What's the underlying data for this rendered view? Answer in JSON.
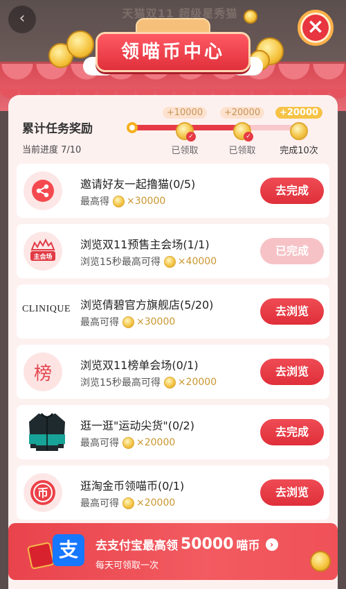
{
  "header": {
    "back_glyph": "‹",
    "title": "天猫双11 超级星秀猫",
    "banner": "领喵币中心",
    "close_glyph": "×"
  },
  "progress": {
    "title": "累计任务奖励",
    "current": "当前进度 7/10",
    "value_fraction": 0.7,
    "milestones": [
      {
        "reward": "+10000",
        "label": "已领取",
        "claimed": true
      },
      {
        "reward": "+20000",
        "label": "已领取",
        "claimed": true
      },
      {
        "reward": "+20000",
        "label": "完成10次",
        "claimed": false
      }
    ]
  },
  "tasks": [
    {
      "title": "邀请好友一起撸猫(0/5)",
      "reward_prefix": "最高得",
      "amount": "×30000",
      "button": "去完成",
      "done": false,
      "icon": "share-icon"
    },
    {
      "title": "浏览双11预售主会场(1/1)",
      "reward_prefix": "浏览15秒最高可得",
      "amount": "×40000",
      "button": "已完成",
      "done": true,
      "icon": "venue-icon",
      "icon_text": "主会场"
    },
    {
      "title": "浏览倩碧官方旗舰店(5/20)",
      "reward_prefix": "最高可得",
      "amount": "×30000",
      "button": "去浏览",
      "done": false,
      "icon": "clinique-logo",
      "icon_text": "CLINIQUE"
    },
    {
      "title": "浏览双11榜单会场(0/1)",
      "reward_prefix": "浏览15秒最高可得",
      "amount": "×20000",
      "button": "去浏览",
      "done": false,
      "icon": "ranking-icon",
      "icon_text": "榜"
    },
    {
      "title": "逛一逛\"运动尖货\"(0/2)",
      "reward_prefix": "最高可得",
      "amount": "×20000",
      "button": "去完成",
      "done": false,
      "icon": "jacket-image"
    },
    {
      "title": "逛淘金币领喵币(0/1)",
      "reward_prefix": "最高可得",
      "amount": "×20000",
      "button": "去浏览",
      "done": false,
      "icon": "taobao-coin-icon",
      "icon_text": "币"
    }
  ],
  "alipay": {
    "logo_text": "支",
    "title_prefix": "去支付宝最高领",
    "title_amount": "50000",
    "title_suffix": "喵币",
    "arrow": "›",
    "subtitle": "每天可领取一次"
  },
  "colors": {
    "accent": "#e63b46",
    "coin": "#f4c64a",
    "alipay": "#1677ff"
  }
}
